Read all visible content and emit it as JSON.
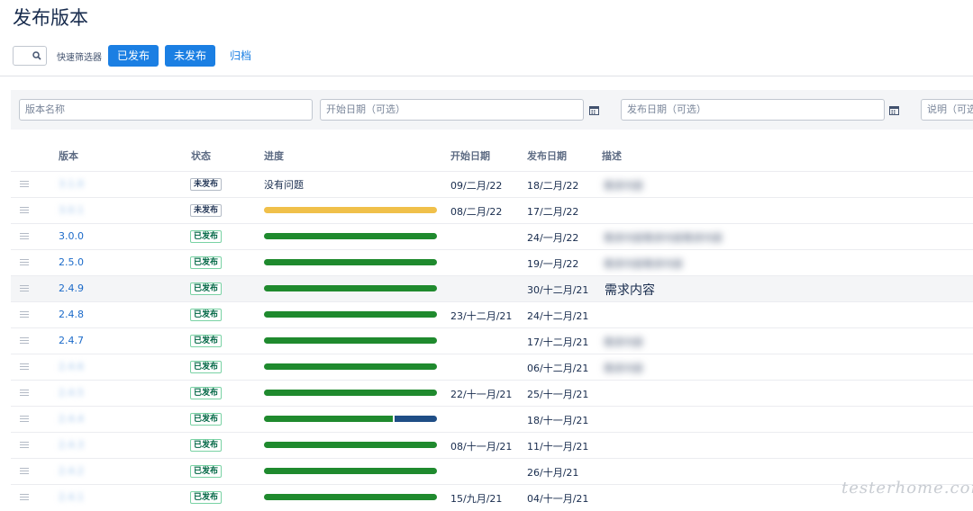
{
  "page": {
    "title": "发布版本"
  },
  "toolbar": {
    "quick_filter_label": "快速筛选器",
    "released_button": "已发布",
    "unreleased_button": "未发布",
    "archived_link": "归档"
  },
  "form": {
    "version_name_placeholder": "版本名称",
    "start_date_placeholder": "开始日期（可选）",
    "release_date_placeholder": "发布日期（可选）",
    "description_placeholder": "说明（可选）"
  },
  "table": {
    "headers": {
      "version": "版本",
      "status": "状态",
      "progress": "进度",
      "start_date": "开始日期",
      "release_date": "发布日期",
      "description": "描述"
    },
    "rows": [
      {
        "version": "3.1.0",
        "status": "未发布",
        "progress_text": "没有问题",
        "start_date": "09/二月/22",
        "release_date": "18/二月/22",
        "description": "需求内容",
        "blurred": true
      },
      {
        "version": "3.0.1",
        "status": "未发布",
        "progress_yellow": 1.0,
        "start_date": "08/二月/22",
        "release_date": "17/二月/22",
        "description": "",
        "blurred": true
      },
      {
        "version": "3.0.0",
        "status": "已发布",
        "progress_green": 1.0,
        "start_date": "",
        "release_date": "24/一月/22",
        "description": "需求内容需求内容需求内容"
      },
      {
        "version": "2.5.0",
        "status": "已发布",
        "progress_green": 1.0,
        "start_date": "",
        "release_date": "19/一月/22",
        "description": "需求内容需求内容"
      },
      {
        "version": "2.4.9",
        "status": "已发布",
        "progress_green": 1.0,
        "start_date": "",
        "release_date": "30/十二月/21",
        "description": "需求内容",
        "highlight": true
      },
      {
        "version": "2.4.8",
        "status": "已发布",
        "progress_green": 1.0,
        "start_date": "23/十二月/21",
        "release_date": "24/十二月/21",
        "description": ""
      },
      {
        "version": "2.4.7",
        "status": "已发布",
        "progress_green": 1.0,
        "start_date": "",
        "release_date": "17/十二月/21",
        "description": "需求内容"
      },
      {
        "version": "2.4.6",
        "status": "已发布",
        "progress_green": 1.0,
        "start_date": "",
        "release_date": "06/十二月/21",
        "description": "需求内容",
        "blurred": true
      },
      {
        "version": "2.4.5",
        "status": "已发布",
        "progress_green": 1.0,
        "start_date": "22/十一月/21",
        "release_date": "25/十一月/21",
        "description": "",
        "blurred": true
      },
      {
        "version": "2.4.4",
        "status": "已发布",
        "progress_green": 0.75,
        "progress_blue": 0.25,
        "start_date": "",
        "release_date": "18/十一月/21",
        "description": "",
        "blurred": true
      },
      {
        "version": "2.4.3",
        "status": "已发布",
        "progress_green": 1.0,
        "start_date": "08/十一月/21",
        "release_date": "11/十一月/21",
        "description": "",
        "blurred": true
      },
      {
        "version": "2.4.2",
        "status": "已发布",
        "progress_green": 1.0,
        "start_date": "",
        "release_date": "26/十月/21",
        "description": "",
        "blurred": true
      },
      {
        "version": "2.4.1",
        "status": "已发布",
        "progress_green": 1.0,
        "start_date": "15/九月/21",
        "release_date": "04/十一月/21",
        "description": "",
        "blurred": true
      }
    ]
  },
  "watermark": "testerhome.com",
  "colors": {
    "accent": "#1b7fe3",
    "released_green": "#1f8a2e",
    "in_progress_yellow": "#f0c04a",
    "in_progress_blue": "#1f4e86"
  }
}
